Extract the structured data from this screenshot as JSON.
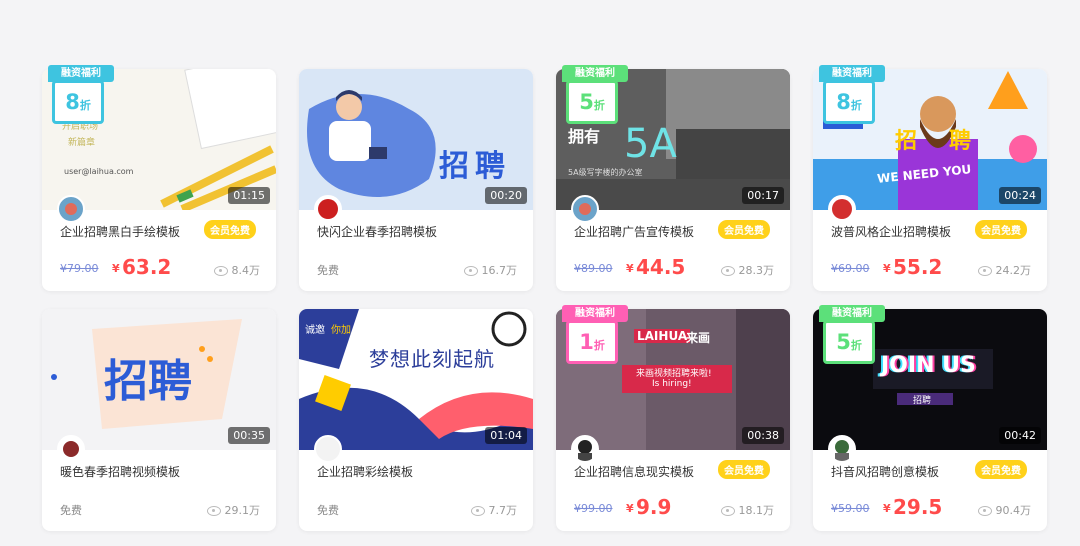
{
  "cards": [
    {
      "title": "企业招聘黑白手绘模板",
      "duration": "01:15",
      "discount": {
        "ribbon": "融资福利",
        "num": "8",
        "unit": "折",
        "color": "#3ec4e0"
      },
      "badge": "会员免费",
      "price": {
        "old": "¥79.00",
        "yen": "¥",
        "now": "63.2"
      },
      "views": "8.4万",
      "thumb_text": [
        "user@laihua.com"
      ]
    },
    {
      "title": "快闪企业春季招聘模板",
      "duration": "00:20",
      "discount": null,
      "badge": "",
      "price": {
        "free": "免费"
      },
      "views": "16.7万",
      "thumb_text": [
        "招",
        "聘"
      ]
    },
    {
      "title": "企业招聘广告宣传模板",
      "duration": "00:17",
      "discount": {
        "ribbon": "融资福利",
        "num": "5",
        "unit": "折",
        "color": "#5ce07a"
      },
      "badge": "会员免费",
      "price": {
        "old": "¥89.00",
        "yen": "¥",
        "now": "44.5"
      },
      "views": "28.3万",
      "thumb_text": [
        "拥有",
        "5A",
        "5A级写字楼的办公室"
      ]
    },
    {
      "title": "波普风格企业招聘模板",
      "duration": "00:24",
      "discount": {
        "ribbon": "融资福利",
        "num": "8",
        "unit": "折",
        "color": "#3ec4e0"
      },
      "badge": "会员免费",
      "price": {
        "old": "¥69.00",
        "yen": "¥",
        "now": "55.2"
      },
      "views": "24.2万",
      "thumb_text": [
        "招",
        "聘",
        "WE NEED YOU"
      ]
    },
    {
      "title": "暖色春季招聘视频模板",
      "duration": "00:35",
      "discount": null,
      "badge": "",
      "price": {
        "free": "免费"
      },
      "views": "29.1万",
      "thumb_text": [
        "招聘"
      ]
    },
    {
      "title": "企业招聘彩绘模板",
      "duration": "01:04",
      "discount": null,
      "badge": "",
      "price": {
        "free": "免费"
      },
      "views": "7.7万",
      "thumb_text": [
        "梦想此刻起航",
        "诚邀",
        "你加"
      ]
    },
    {
      "title": "企业招聘信息现实模板",
      "duration": "00:38",
      "discount": {
        "ribbon": "融资福利",
        "num": "1",
        "unit": "折",
        "color": "#ff5fb4"
      },
      "badge": "会员免费",
      "price": {
        "old": "¥99.00",
        "yen": "¥",
        "now": "9.9"
      },
      "views": "18.1万",
      "thumb_text": [
        "LAIHUA",
        "来画",
        "来画视频招聘来啦!",
        "Is hiring!"
      ]
    },
    {
      "title": "抖音风招聘创意模板",
      "duration": "00:42",
      "discount": {
        "ribbon": "融资福利",
        "num": "5",
        "unit": "折",
        "color": "#5ce07a"
      },
      "badge": "会员免费",
      "price": {
        "old": "¥59.00",
        "yen": "¥",
        "now": "29.5"
      },
      "views": "90.4万",
      "thumb_text": [
        "JOIN US",
        "招聘"
      ]
    }
  ]
}
